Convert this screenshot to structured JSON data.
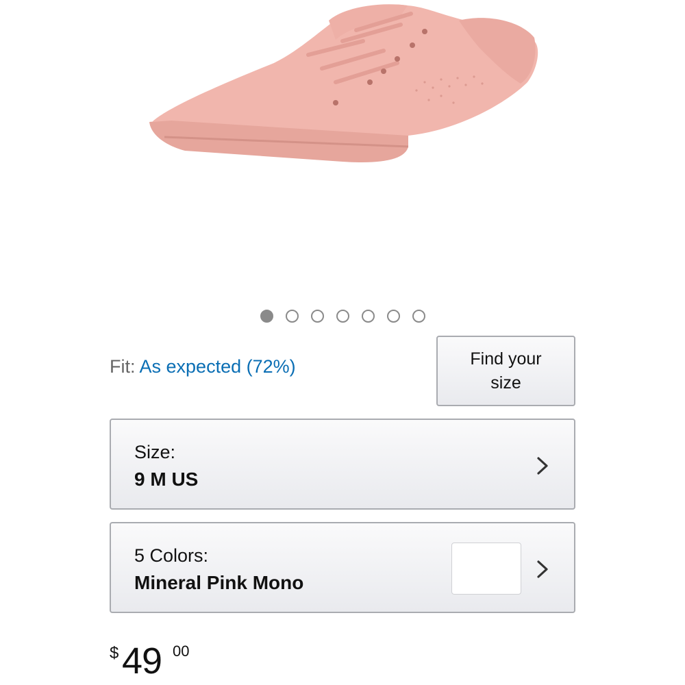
{
  "product": {
    "image_alt": "Pink perforated lace-up sneaker",
    "image_color": "#e9a9a0"
  },
  "carousel": {
    "count": 7,
    "active_index": 0
  },
  "fit": {
    "label": "Fit:",
    "value": "As expected (72%)"
  },
  "find_size_button": {
    "label": "Find your size"
  },
  "size_selector": {
    "label": "Size:",
    "value": "9 M US"
  },
  "color_selector": {
    "label": "5 Colors:",
    "value": "Mineral Pink Mono"
  },
  "price": {
    "currency": "$",
    "whole": "49",
    "fraction": "00"
  },
  "colors": {
    "link": "#0a6eb4",
    "button_border": "#a9abb0"
  }
}
